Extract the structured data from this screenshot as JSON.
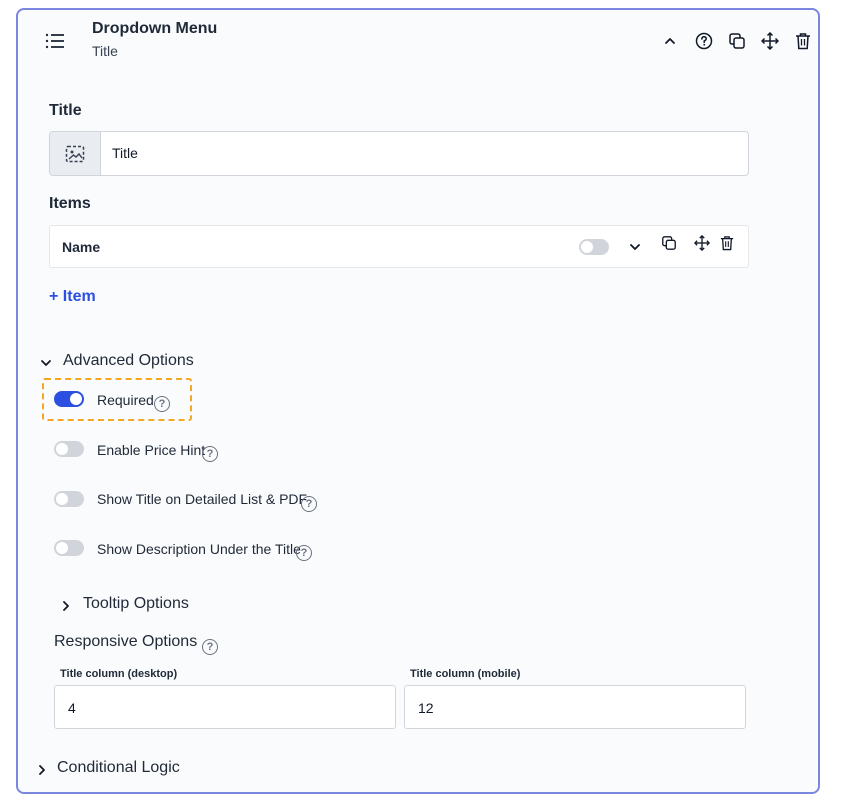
{
  "header": {
    "title": "Dropdown Menu",
    "subtitle": "Title"
  },
  "toolbar": {
    "icons": [
      "chevron-up-icon",
      "help-circle-icon",
      "copy-icon",
      "move-icon",
      "trash-icon"
    ]
  },
  "title_field": {
    "label": "Title",
    "value": "Title"
  },
  "items_field": {
    "label": "Items",
    "rows": [
      {
        "name": "Name",
        "enabled": false
      }
    ]
  },
  "add_item": {
    "label": "+ Item"
  },
  "advanced": {
    "label": "Advanced Options",
    "options": [
      {
        "label": "Required",
        "on": true
      },
      {
        "label": "Enable Price Hint",
        "on": false
      },
      {
        "label": "Show Title on Detailed List & PDF",
        "on": false
      },
      {
        "label": "Show Description Under the Title",
        "on": false
      }
    ],
    "tooltip_label": "Tooltip Options",
    "help_glyph": "?"
  },
  "responsive": {
    "label": "Responsive Options",
    "desktop_label": "Title column (desktop)",
    "desktop_value": "4",
    "mobile_label": "Title column (mobile)",
    "mobile_value": "12"
  },
  "conditional": {
    "label": "Conditional Logic"
  },
  "colors": {
    "accent": "#2b4fe0",
    "border": "#7b86e0",
    "highlight": "#f5a623"
  }
}
